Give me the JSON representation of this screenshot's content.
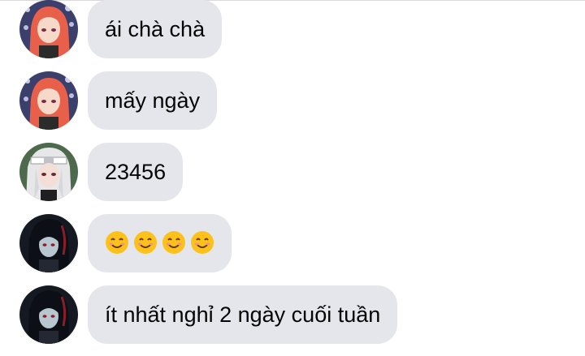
{
  "messages": [
    {
      "sender_avatar": "avatar-red-hair",
      "text": "ái chà chà"
    },
    {
      "sender_avatar": "avatar-red-hair",
      "text": "mấy ngày"
    },
    {
      "sender_avatar": "avatar-white-hair",
      "text": "23456"
    },
    {
      "sender_avatar": "avatar-dark-hair",
      "emoji": [
        "smiling-face",
        "smiling-face",
        "smiling-face",
        "smiling-face"
      ]
    },
    {
      "sender_avatar": "avatar-dark-hair",
      "text": "ít nhất nghỉ 2 ngày cuối tuần"
    }
  ],
  "colors": {
    "bubble_bg": "#e4e6eb",
    "text": "#050505",
    "divider": "#d9d9d9"
  }
}
